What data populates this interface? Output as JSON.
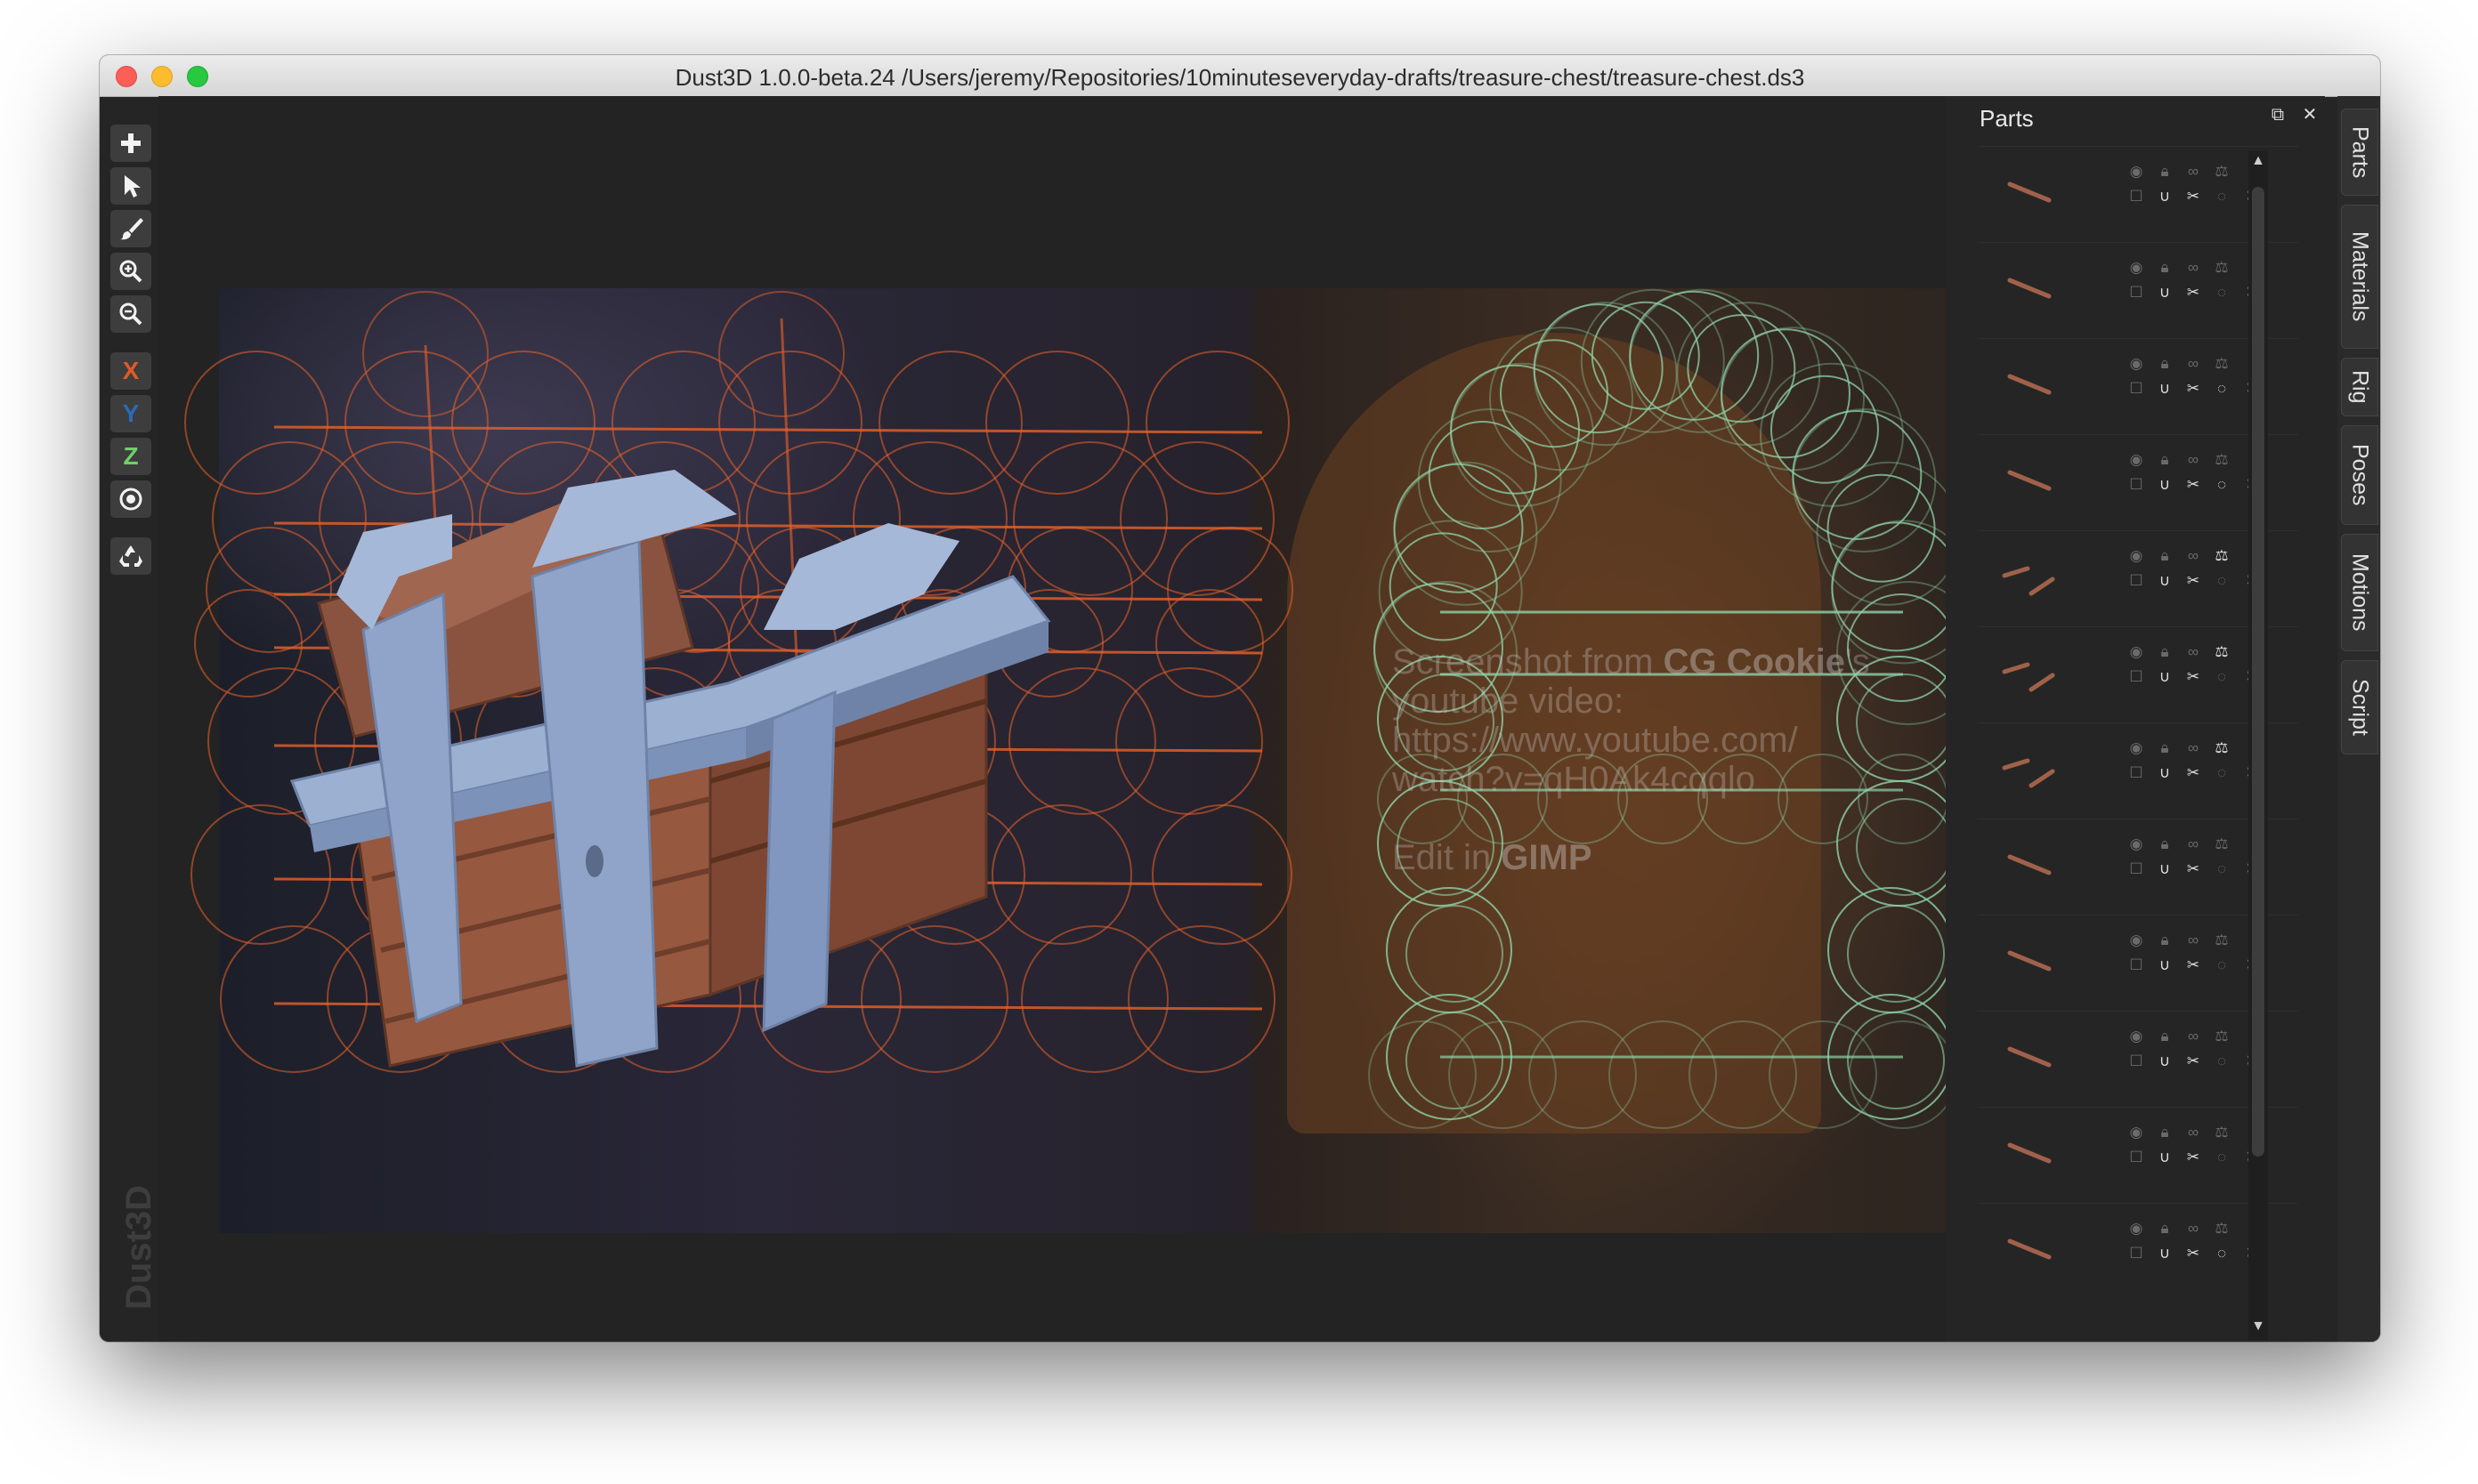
{
  "window": {
    "title": "Dust3D 1.0.0-beta.24 /Users/jeremy/Repositories/10minuteseveryday-drafts/treasure-chest/treasure-chest.ds3"
  },
  "toolbar": {
    "buttons": [
      {
        "icon": "plus-icon",
        "label": ""
      },
      {
        "icon": "pointer-icon",
        "label": ""
      },
      {
        "icon": "paintbrush-icon",
        "label": ""
      },
      {
        "icon": "zoom-in-icon",
        "label": ""
      },
      {
        "icon": "zoom-out-icon",
        "label": ""
      },
      {
        "icon": "x-axis-mirror",
        "label": "X"
      },
      {
        "icon": "y-axis-mirror",
        "label": "Y"
      },
      {
        "icon": "z-axis-mirror",
        "label": "Z"
      },
      {
        "icon": "radial-mirror-icon",
        "label": ""
      },
      {
        "icon": "recycle-icon",
        "label": ""
      }
    ],
    "axis_colors": {
      "x": "#e05a27",
      "y": "#2b6ab8",
      "z": "#6fd06a"
    }
  },
  "viewport": {
    "watermark": {
      "line1_prefix": "Screenshot from ",
      "line1_bold": "CG Cookie",
      "line1_suffix": "'s",
      "line2": "youtube video:",
      "line3": "https://www.youtube.com/",
      "line4": "watch?v=qH0Ak4cqqlo",
      "line5_prefix": "Edit in ",
      "line5_bold": "GIMP"
    },
    "logo": "Dust3D",
    "colors": {
      "front_view_wire": "#e9622a",
      "side_view_wire": "#8fd3a8",
      "chest_band": "#8fa4c8",
      "chest_wood": "#9a5f45"
    }
  },
  "parts_panel": {
    "title": "Parts",
    "tabs": [
      "Parts",
      "Materials",
      "Rig",
      "Poses",
      "Motions",
      "Script"
    ],
    "row_icons": [
      "eye-icon",
      "lock-icon",
      "link-icon",
      "balance-icon",
      "color-picker-icon",
      "checkbox-icon",
      "magnet-icon",
      "scissors-icon",
      "round-icon",
      "chamfer-icon"
    ],
    "rows": [
      {
        "thumb": "single",
        "balance_on": false,
        "round_on": false
      },
      {
        "thumb": "single",
        "balance_on": false,
        "round_on": false
      },
      {
        "thumb": "single",
        "balance_on": false,
        "round_on": true
      },
      {
        "thumb": "single",
        "balance_on": false,
        "round_on": true
      },
      {
        "thumb": "double",
        "balance_on": true,
        "round_on": false
      },
      {
        "thumb": "double",
        "balance_on": true,
        "round_on": false
      },
      {
        "thumb": "double",
        "balance_on": true,
        "round_on": false
      },
      {
        "thumb": "single",
        "balance_on": false,
        "round_on": false
      },
      {
        "thumb": "single",
        "balance_on": false,
        "round_on": false
      },
      {
        "thumb": "single",
        "balance_on": false,
        "round_on": false
      },
      {
        "thumb": "single",
        "balance_on": false,
        "round_on": false
      },
      {
        "thumb": "single",
        "balance_on": false,
        "round_on": true
      }
    ]
  }
}
